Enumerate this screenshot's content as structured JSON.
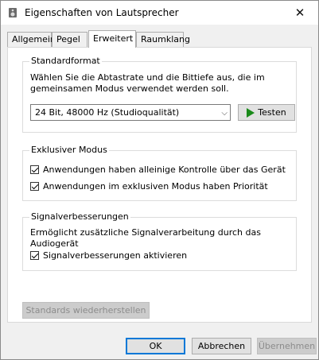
{
  "window": {
    "title": "Eigenschaften von Lautsprecher"
  },
  "tabs": [
    {
      "label": "Allgemein",
      "active": false
    },
    {
      "label": "Pegel",
      "active": false
    },
    {
      "label": "Erweitert",
      "active": true
    },
    {
      "label": "Raumklang",
      "active": false
    }
  ],
  "standardformat": {
    "legend": "Standardformat",
    "description": "Wählen Sie die Abtastrate und die Bittiefe aus, die im gemeinsamen Modus verwendet werden soll.",
    "selected_format": "24 Bit, 48000 Hz (Studioqualität)",
    "test_button": "Testen"
  },
  "exclusive": {
    "legend": "Exklusiver Modus",
    "options": [
      {
        "label": "Anwendungen haben alleinige Kontrolle über das Gerät",
        "checked": true
      },
      {
        "label": "Anwendungen im exklusiven Modus haben Priorität",
        "checked": true
      }
    ]
  },
  "enhancements": {
    "legend": "Signalverbesserungen",
    "description": "Ermöglicht zusätzliche Signalverarbeitung durch das Audiogerät",
    "option": {
      "label": "Signalverbesserungen aktivieren",
      "checked": true
    }
  },
  "restore_defaults": "Standards wiederherstellen",
  "footer": {
    "ok": "OK",
    "cancel": "Abbrechen",
    "apply": "Übernehmen"
  },
  "colors": {
    "play": "#1a8a1a",
    "default_border": "#0078d7"
  }
}
